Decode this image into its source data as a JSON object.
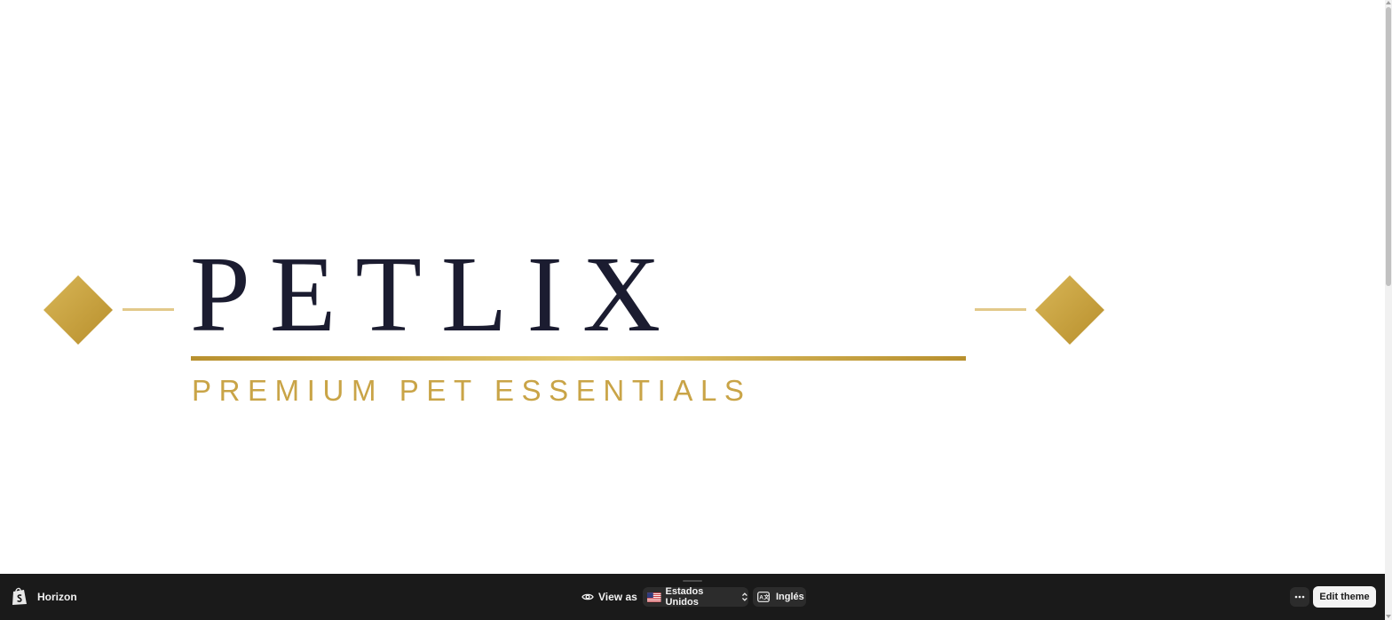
{
  "store_preview": {
    "brand": {
      "wordmark": "PETLIX",
      "tagline": "PREMIUM PET ESSENTIALS",
      "colors": {
        "wordmark": "#1b1c30",
        "gold": "#c9a447"
      }
    }
  },
  "preview_bar": {
    "theme_name": "Horizon",
    "view_as_label": "View as",
    "country": {
      "label": "Estados Unidos",
      "flag": "us-flag-icon"
    },
    "language": {
      "label": "Inglés",
      "icon": "translate-icon"
    },
    "more_icon": "ellipsis-icon",
    "edit_theme_label": "Edit theme",
    "colors": {
      "background": "#1a1a1a",
      "pill": "#2c2c2c"
    }
  }
}
